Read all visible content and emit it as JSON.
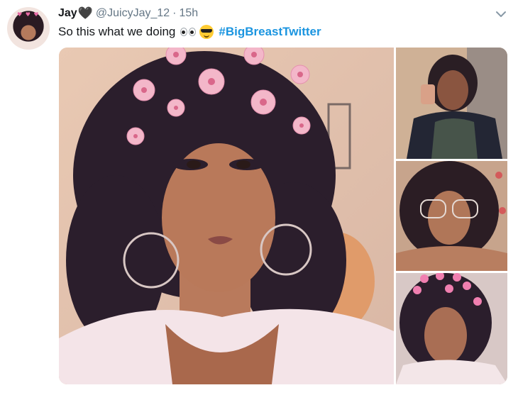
{
  "tweet": {
    "display_name": "Jay",
    "name_emoji": "🖤",
    "handle": "@JuicyJay_12",
    "separator": "·",
    "time": "15h",
    "text": "So this what we doing",
    "hashtag": "#BigBreastTwitter"
  },
  "colors": {
    "text": "#14171a",
    "secondary": "#657786",
    "link": "#1b95e0"
  },
  "icons": [
    "eyes-emoji",
    "sunglasses-emoji",
    "chevron-down-icon"
  ]
}
